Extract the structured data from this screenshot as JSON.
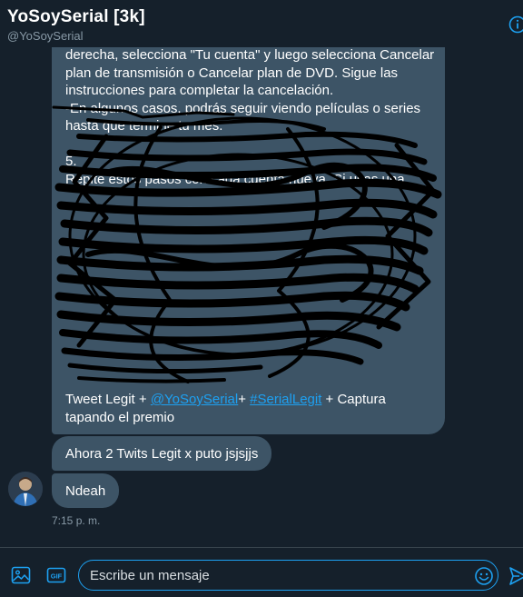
{
  "header": {
    "title": "YoSoySerial [3k]",
    "handle": "@YoSoySerial",
    "info_icon": "info-icon"
  },
  "conversation": {
    "main_message": {
      "lines": [
        "derecha, selecciona \"Tu cuenta\" y luego selecciona Cancelar",
        "plan de transmisión o Cancelar plan de DVD. Sigue las",
        "instrucciones para completar la cancelación.",
        "-En algunos casos, podrás seguir viendo películas o series",
        "hasta que termine tu mes.",
        "",
        "5.",
        "Repite estos pasos con cada cuenta nueva. Si usas una"
      ],
      "footer_line1_prefix": "Tweet Legit + ",
      "footer_mention": "@YoSoySerial",
      "footer_plus": "+ ",
      "footer_hashtag": "#SerialLegit",
      "footer_line1_suffix": " + Captura",
      "footer_line2": "tapando el premio"
    },
    "message_2": "Ahora 2 Twits Legit x puto jsjsjjs",
    "message_3": "Ndeah",
    "timestamp": "7:15 p. m."
  },
  "composer": {
    "placeholder": "Escribe un mensaje",
    "media_icon": "image-icon",
    "gif_label": "GIF",
    "emoji_icon": "emoji-icon",
    "send_icon": "send-icon"
  },
  "colors": {
    "background": "#15202b",
    "bubble": "#3d5466",
    "accent": "#1da1f2",
    "muted": "#8899a6"
  }
}
